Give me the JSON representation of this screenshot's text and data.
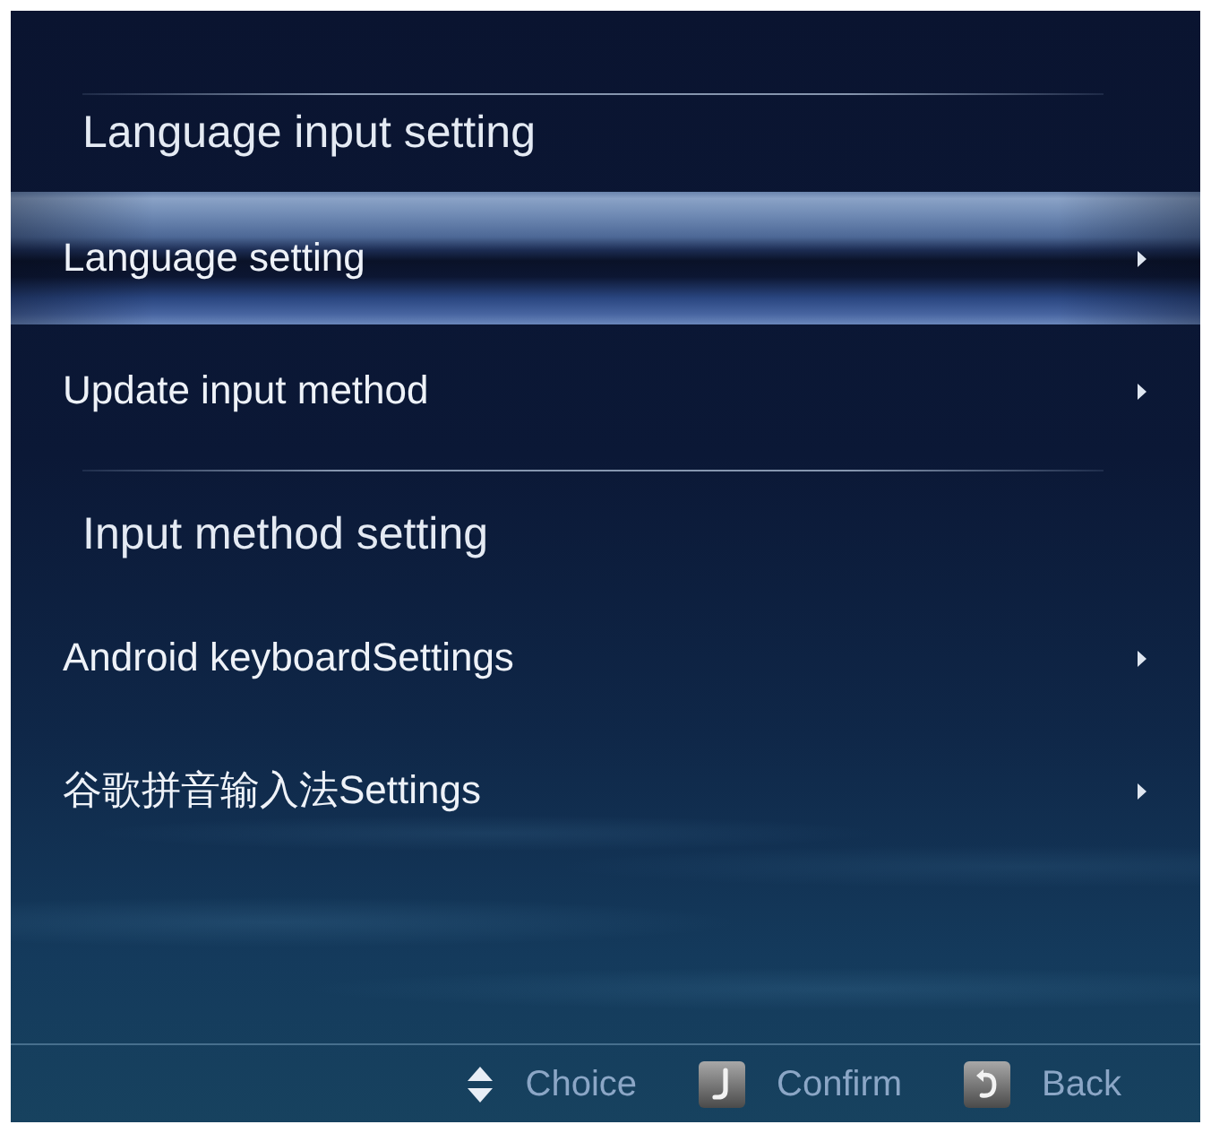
{
  "sections": [
    {
      "heading": "Language input setting",
      "items": [
        {
          "label": "Language setting",
          "selected": true
        },
        {
          "label": "Update input method",
          "selected": false
        }
      ]
    },
    {
      "heading": "Input method setting",
      "items": [
        {
          "label": "Android keyboardSettings",
          "selected": false
        },
        {
          "label": "谷歌拼音输入法Settings",
          "selected": false
        }
      ]
    }
  ],
  "footer": {
    "hints": [
      {
        "kind": "updown",
        "label": "Choice"
      },
      {
        "kind": "enter",
        "label": "Confirm"
      },
      {
        "kind": "back",
        "label": "Back"
      }
    ]
  }
}
